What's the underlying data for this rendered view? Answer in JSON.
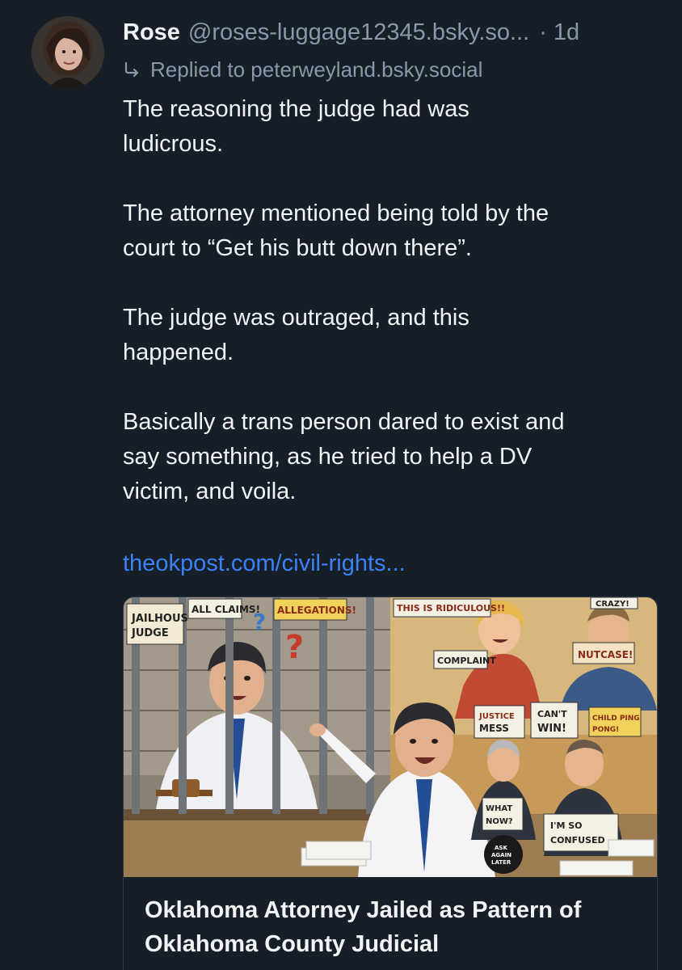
{
  "post": {
    "display_name": "Rose",
    "handle": "@roses-luggage12345.bsky.so...",
    "time": "· 1d",
    "reply_to": "Replied to peterweyland.bsky.social",
    "paragraphs": [
      "The reasoning the judge had was\nludicrous.",
      "The attorney mentioned being told by the\ncourt to “Get his butt down there”.",
      "The judge was outraged, and this\nhappened.",
      "Basically a trans person dared to exist and\nsay something, as he tried to help a DV\nvictim, and voila."
    ],
    "link_text": "theokpost.com/civil-rights...",
    "card": {
      "title": "Oklahoma Attorney Jailed as Pattern of Oklahoma County Judicial",
      "image_signs": {
        "jailhouse": "JAILHOUS JUDGE",
        "all_claims": "ALL CLAIMS!",
        "allegations": "ALLEGATIONS!",
        "ridiculous": "THIS IS RIDICULOUS!!",
        "crazy": "CRAZY!",
        "complaint": "COMPLAINT",
        "nutcase": "NUTCASE!",
        "justice_mess": "JUSTICE MESS",
        "cant_win": "CAN'T WIN!",
        "child_ping_pong": "CHILD PING PONG!",
        "what_now": "WHAT NOW?",
        "confused": "I'M SO CONFUSED",
        "ask_again": "ASK AGAIN LATER"
      }
    }
  },
  "icons": {
    "reply": "reply-arrow-icon"
  },
  "colors": {
    "background": "#161e27",
    "text": "#f1f3f5",
    "muted": "#8c98a8",
    "link": "#3b82f6"
  }
}
